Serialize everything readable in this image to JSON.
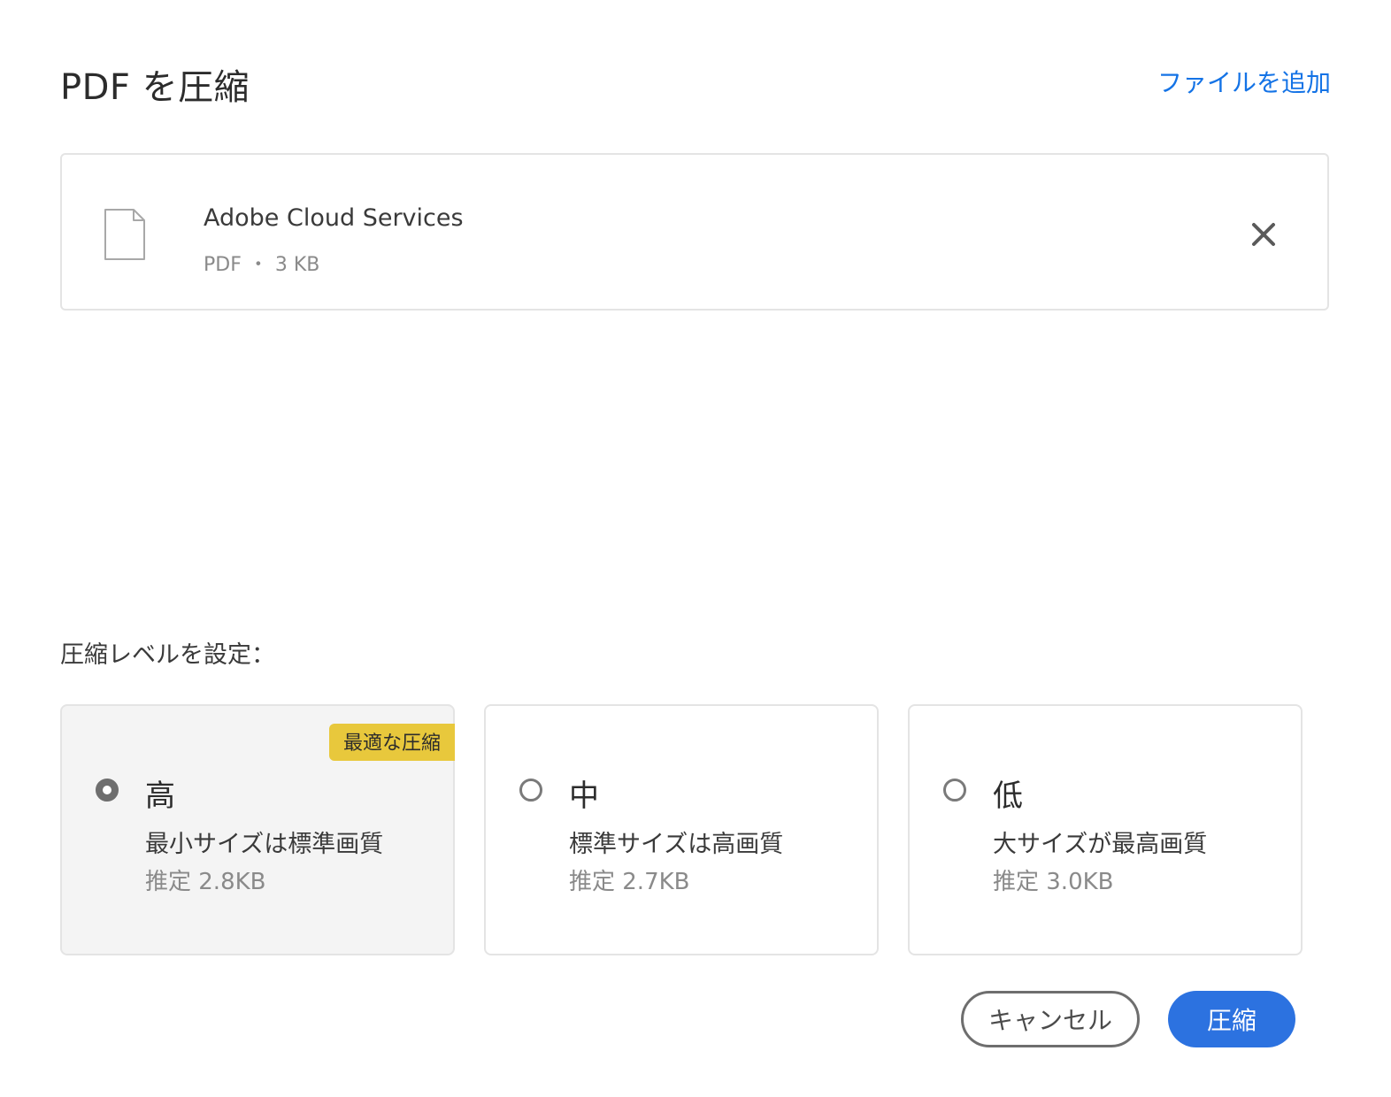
{
  "header": {
    "title": "PDF を圧縮",
    "add_file_label": "ファイルを追加"
  },
  "file": {
    "icon": "document-icon",
    "name": "Adobe Cloud Services",
    "type": "PDF",
    "separator": "・",
    "size": "3 KB",
    "remove_icon": "close-icon"
  },
  "compression": {
    "label": "圧縮レベルを設定：",
    "selected_index": 0,
    "options": [
      {
        "level": "高",
        "description": "最小サイズは標準画質",
        "estimate": "推定 2.8KB",
        "badge": "最適な圧縮",
        "selected": true
      },
      {
        "level": "中",
        "description": "標準サイズは高画質",
        "estimate": "推定 2.7KB",
        "selected": false
      },
      {
        "level": "低",
        "description": "大サイズが最高画質",
        "estimate": "推定 3.0KB",
        "selected": false
      }
    ]
  },
  "footer": {
    "cancel_label": "キャンセル",
    "compress_label": "圧縮"
  },
  "colors": {
    "accent": "#2c72e0",
    "link": "#1473e6",
    "badge": "#e8c83c",
    "selected_bg": "#f4f4f4"
  }
}
